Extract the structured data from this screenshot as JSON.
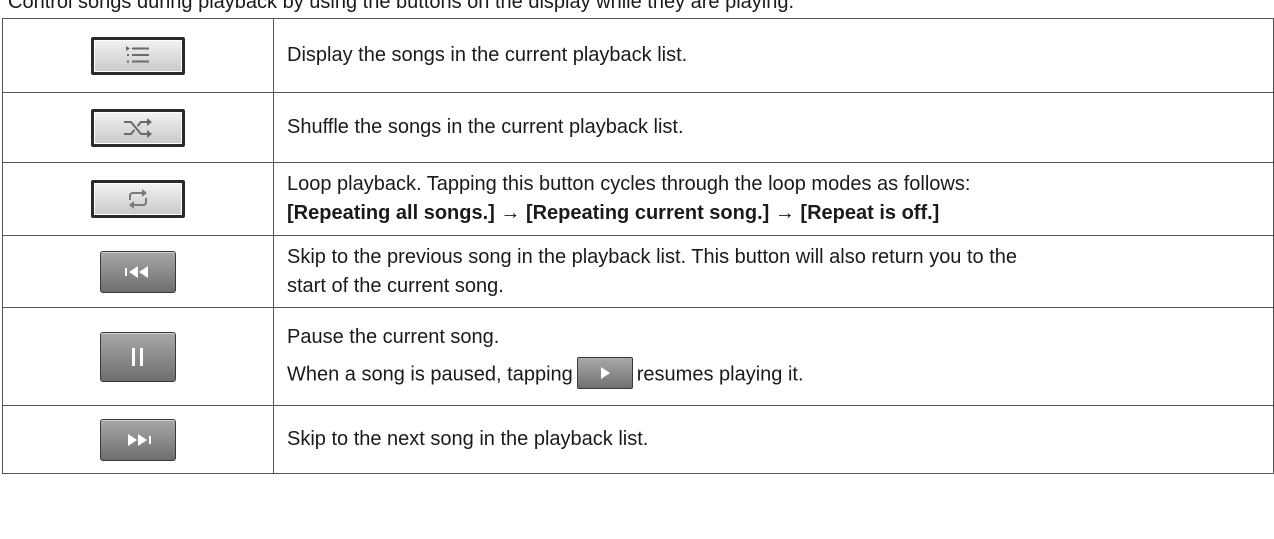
{
  "intro_text": "Control songs during playback by using the buttons on the display while they are playing.",
  "rows": [
    {
      "icon": "list-icon",
      "text": "Display the songs in the current playback list."
    },
    {
      "icon": "shuffle-icon",
      "text": "Shuffle the songs in the current playback list."
    },
    {
      "icon": "repeat-icon",
      "text": "Loop playback. Tapping this button cycles through the loop modes as follows:",
      "modes": {
        "all": "[Repeating all songs.]",
        "arrow": "→",
        "current": "[Repeating current song.]",
        "off": "[Repeat is off.]"
      }
    },
    {
      "icon": "previous-track-icon",
      "text_line1": "Skip to the previous song in the playback list. This button will also return you to the",
      "text_line2": "start of the current song."
    },
    {
      "icon": "pause-icon",
      "text_line1": "Pause the current song.",
      "text_line2_before": "When a song is paused, tapping",
      "inline_icon": "play-icon",
      "text_line2_after": "resumes playing it."
    },
    {
      "icon": "next-track-icon",
      "text": "Skip to the next song in the playback list."
    }
  ]
}
